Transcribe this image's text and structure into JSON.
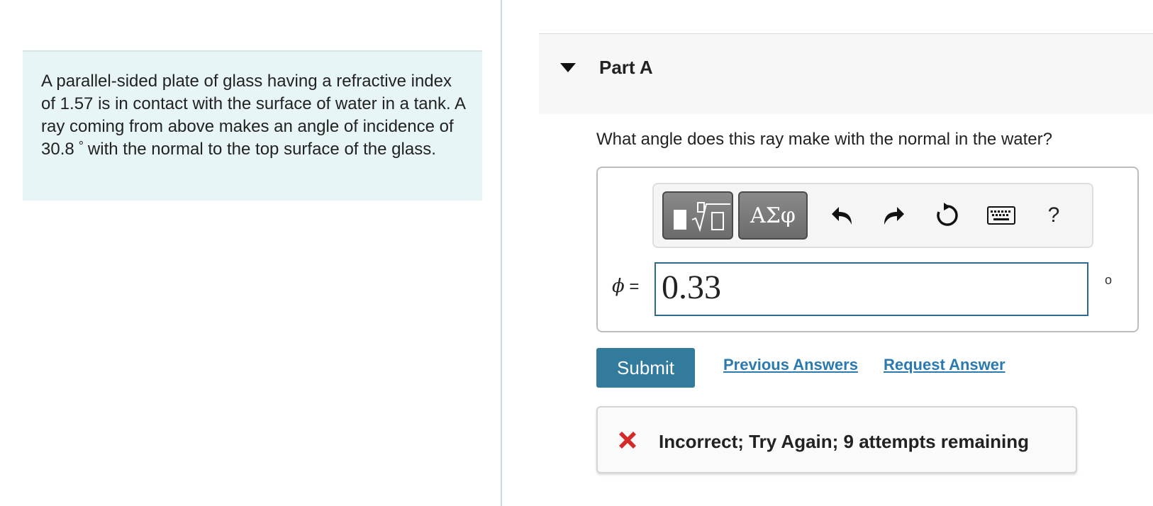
{
  "problem": {
    "text_before_degree": "A parallel-sided plate of glass having a refractive index of 1.57 is in contact with the surface of water in a tank. A ray coming from above makes an angle of incidence of 30.8",
    "degree_symbol": "°",
    "text_after_degree": "with the normal to the top surface of the glass."
  },
  "part": {
    "title": "Part A",
    "question": "What angle does this ray make with the normal in the water?"
  },
  "toolbar": {
    "symbols_label": "ΑΣφ",
    "help_label": "?"
  },
  "answer": {
    "variable": "ϕ",
    "equals": " =",
    "value": "0.33",
    "unit": "o"
  },
  "actions": {
    "submit_label": "Submit",
    "previous_answers_label": "Previous Answers",
    "request_answer_label": "Request Answer"
  },
  "feedback": {
    "message": "Incorrect; Try Again; 9 attempts remaining"
  },
  "colors": {
    "accent": "#337b9d",
    "link": "#2a7ab0",
    "error": "#d42a2a",
    "problem_bg": "#e8f5f6"
  }
}
